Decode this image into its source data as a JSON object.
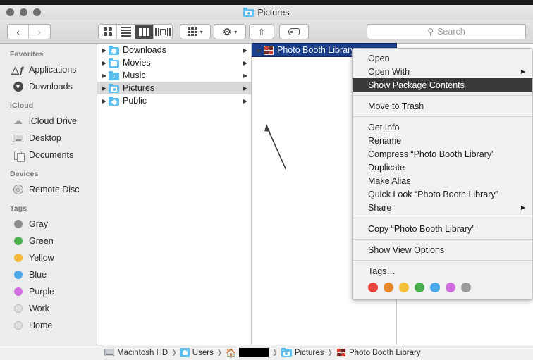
{
  "window": {
    "title": "Pictures",
    "title_icon": "pictures-folder-icon",
    "traffic_lights": [
      "close",
      "minimize",
      "zoom"
    ]
  },
  "toolbar": {
    "back_label": "‹",
    "forward_label": "›",
    "view_buttons": [
      {
        "name": "icon-view",
        "active": false
      },
      {
        "name": "list-view",
        "active": false
      },
      {
        "name": "column-view",
        "active": true
      },
      {
        "name": "coverflow-view",
        "active": false
      }
    ],
    "arrange_label": "arrange-icon",
    "action_label": "gear-icon",
    "share_label": "share-icon",
    "tag_label": "tag-icon"
  },
  "search": {
    "placeholder": "Search",
    "value": "",
    "icon": "search-icon"
  },
  "sidebar": {
    "sections": [
      {
        "header": "Favorites",
        "items": [
          {
            "label": "Applications",
            "icon": "applications-icon"
          },
          {
            "label": "Downloads",
            "icon": "downloads-icon"
          }
        ]
      },
      {
        "header": "iCloud",
        "items": [
          {
            "label": "iCloud Drive",
            "icon": "cloud-icon"
          },
          {
            "label": "Desktop",
            "icon": "desktop-icon"
          },
          {
            "label": "Documents",
            "icon": "documents-icon"
          }
        ]
      },
      {
        "header": "Devices",
        "items": [
          {
            "label": "Remote Disc",
            "icon": "disc-icon"
          }
        ]
      },
      {
        "header": "Tags",
        "items": [
          {
            "label": "Gray",
            "icon": "tag-dot",
            "color": "#8e8e8e"
          },
          {
            "label": "Green",
            "icon": "tag-dot",
            "color": "#4cb050"
          },
          {
            "label": "Yellow",
            "icon": "tag-dot",
            "color": "#f5b93c"
          },
          {
            "label": "Blue",
            "icon": "tag-dot",
            "color": "#4aa8e8"
          },
          {
            "label": "Purple",
            "icon": "tag-dot",
            "color": "#d06ee0"
          },
          {
            "label": "Work",
            "icon": "tag-dot",
            "color": "hollow"
          },
          {
            "label": "Home",
            "icon": "tag-dot",
            "color": "hollow"
          }
        ]
      }
    ]
  },
  "browser": {
    "column1": [
      {
        "label": "Downloads",
        "icon": "downloads-folder-icon",
        "selected": false,
        "has_children": true
      },
      {
        "label": "Movies",
        "icon": "movies-folder-icon",
        "selected": false,
        "has_children": true
      },
      {
        "label": "Music",
        "icon": "music-folder-icon",
        "selected": false,
        "has_children": true
      },
      {
        "label": "Pictures",
        "icon": "pictures-folder-icon",
        "selected": true,
        "has_children": true
      },
      {
        "label": "Public",
        "icon": "public-folder-icon",
        "selected": false,
        "has_children": true
      }
    ],
    "column2": [
      {
        "label": "Photo Booth Library",
        "icon": "photo-booth-library-icon",
        "selected": true,
        "has_children": true
      }
    ]
  },
  "context_menu": {
    "groups": [
      {
        "items": [
          {
            "label": "Open",
            "highlighted": false,
            "submenu": false
          },
          {
            "label": "Open With",
            "highlighted": false,
            "submenu": true
          },
          {
            "label": "Show Package Contents",
            "highlighted": true,
            "submenu": false
          }
        ]
      },
      {
        "items": [
          {
            "label": "Move to Trash",
            "highlighted": false,
            "submenu": false
          }
        ]
      },
      {
        "items": [
          {
            "label": "Get Info",
            "highlighted": false,
            "submenu": false
          },
          {
            "label": "Rename",
            "highlighted": false,
            "submenu": false
          },
          {
            "label": "Compress “Photo Booth Library”",
            "highlighted": false,
            "submenu": false
          },
          {
            "label": "Duplicate",
            "highlighted": false,
            "submenu": false
          },
          {
            "label": "Make Alias",
            "highlighted": false,
            "submenu": false
          },
          {
            "label": "Quick Look “Photo Booth Library”",
            "highlighted": false,
            "submenu": false
          },
          {
            "label": "Share",
            "highlighted": false,
            "submenu": true
          }
        ]
      },
      {
        "items": [
          {
            "label": "Copy “Photo Booth Library”",
            "highlighted": false,
            "submenu": false
          }
        ]
      },
      {
        "items": [
          {
            "label": "Show View Options",
            "highlighted": false,
            "submenu": false
          }
        ]
      }
    ],
    "tags_label": "Tags…",
    "tag_colors": [
      "#e8453c",
      "#e8862a",
      "#f3c13a",
      "#4cb050",
      "#4aa8e8",
      "#d06ee0",
      "#9b9b9b"
    ],
    "submenu_arrow": "▶",
    "highlight_color": "#3a3a3a"
  },
  "path_bar": {
    "items": [
      {
        "label": "Macintosh HD",
        "icon": "hard-disk-icon",
        "redacted": false
      },
      {
        "label": "Users",
        "icon": "users-folder-icon",
        "redacted": false
      },
      {
        "label": "",
        "icon": "home-folder-icon",
        "redacted": true
      },
      {
        "label": "Pictures",
        "icon": "pictures-folder-icon",
        "redacted": false
      },
      {
        "label": "Photo Booth Library",
        "icon": "photo-booth-library-icon",
        "redacted": false
      }
    ],
    "separator": "❯"
  },
  "annotation": {
    "type": "arrow",
    "description": "arrow pointing to Pictures row"
  },
  "colors": {
    "selection_blue": "#1b3f8b",
    "folder_blue": "#5cc0f2",
    "menu_highlight": "#3a3a3a",
    "sidebar_bg": "#ececec"
  }
}
